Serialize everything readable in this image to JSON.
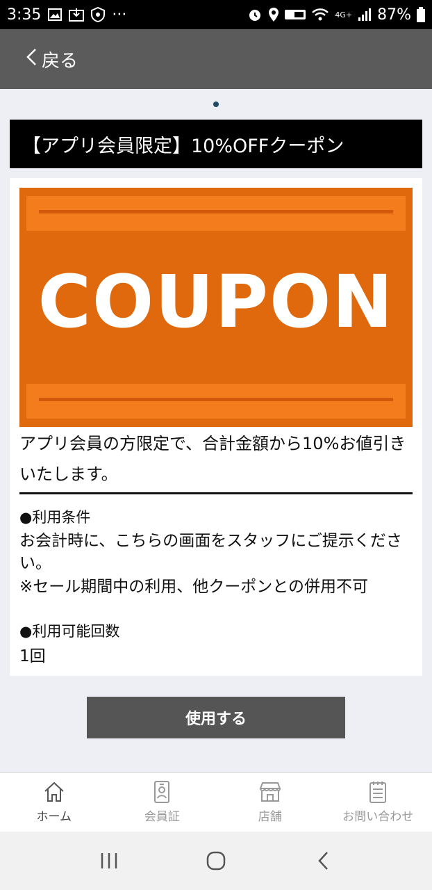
{
  "status_bar": {
    "time": "3:35",
    "dots": "···",
    "network": "4G+",
    "battery": "87%"
  },
  "header": {
    "back_label": "戻る"
  },
  "coupon": {
    "title": "【アプリ会員限定】10%OFFクーポン",
    "image_text": "COUPON",
    "description": "アプリ会員の方限定で、合計金額から10%お値引きいたします。",
    "conditions_heading": "●利用条件",
    "conditions_body": "お会計時に、こちらの画面をスタッフにご提示ください。",
    "conditions_note": "※セール期間中の利用、他クーポンとの併用不可",
    "usage_count_heading": "●利用可能回数",
    "usage_count_value": "1回",
    "use_button_label": "使用する"
  },
  "bottom_nav": {
    "items": [
      {
        "label": "ホーム",
        "icon": "home-icon",
        "active": true
      },
      {
        "label": "会員証",
        "icon": "member-card-icon",
        "active": false
      },
      {
        "label": "店舗",
        "icon": "store-icon",
        "active": false
      },
      {
        "label": "お問い合わせ",
        "icon": "inquiry-icon",
        "active": false
      }
    ]
  },
  "colors": {
    "header_bg": "#5b5b5b",
    "title_bg": "#000000",
    "coupon_orange": "#e0690e",
    "button_bg": "#555555"
  }
}
